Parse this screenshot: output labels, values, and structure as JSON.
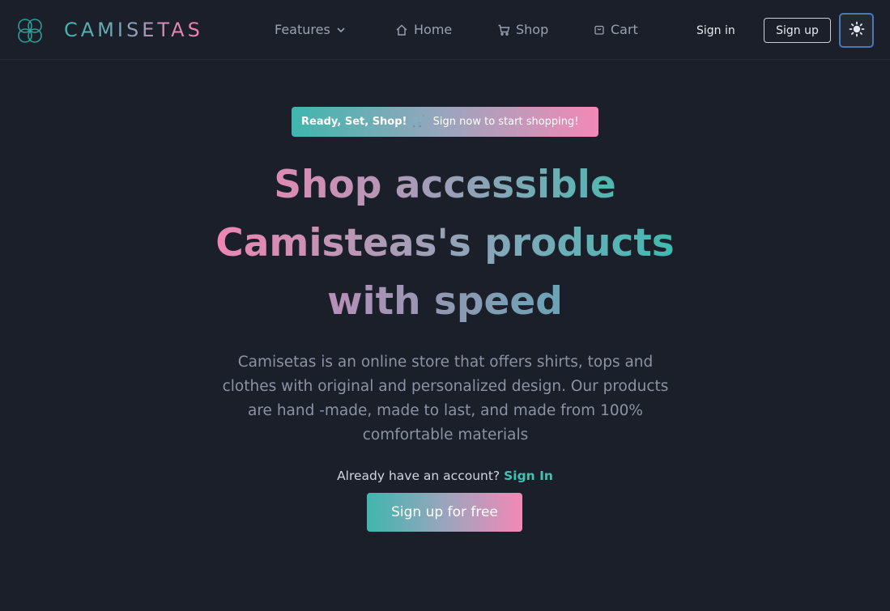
{
  "brand": {
    "name": "CAMISETAS",
    "logo_icon": "flower-logo-icon"
  },
  "nav": {
    "features": "Features",
    "home": "Home",
    "shop": "Shop",
    "cart": "Cart",
    "sign_in": "Sign in",
    "sign_up": "Sign up",
    "theme_icon": "sun-icon"
  },
  "banner": {
    "strong": "Ready, Set, Shop!",
    "emoji": "🛒",
    "text": "Sign now to start shopping!"
  },
  "hero": {
    "line1": "Shop accessible",
    "line2": "Camisteas's products",
    "line3": "with speed"
  },
  "description": "Camisetas is an online store that offers shirts, tops and clothes with original and personalized design. Our products are hand -made, made to last, and made from 100% comfortable materials",
  "account": {
    "prompt": "Already have an account?",
    "link": "Sign In"
  },
  "cta": {
    "label": "Sign up for free"
  },
  "colors": {
    "background": "#1b1f2a",
    "teal": "#3fb6ad",
    "pink": "#ef7fb0",
    "focus": "#4a78b8"
  }
}
